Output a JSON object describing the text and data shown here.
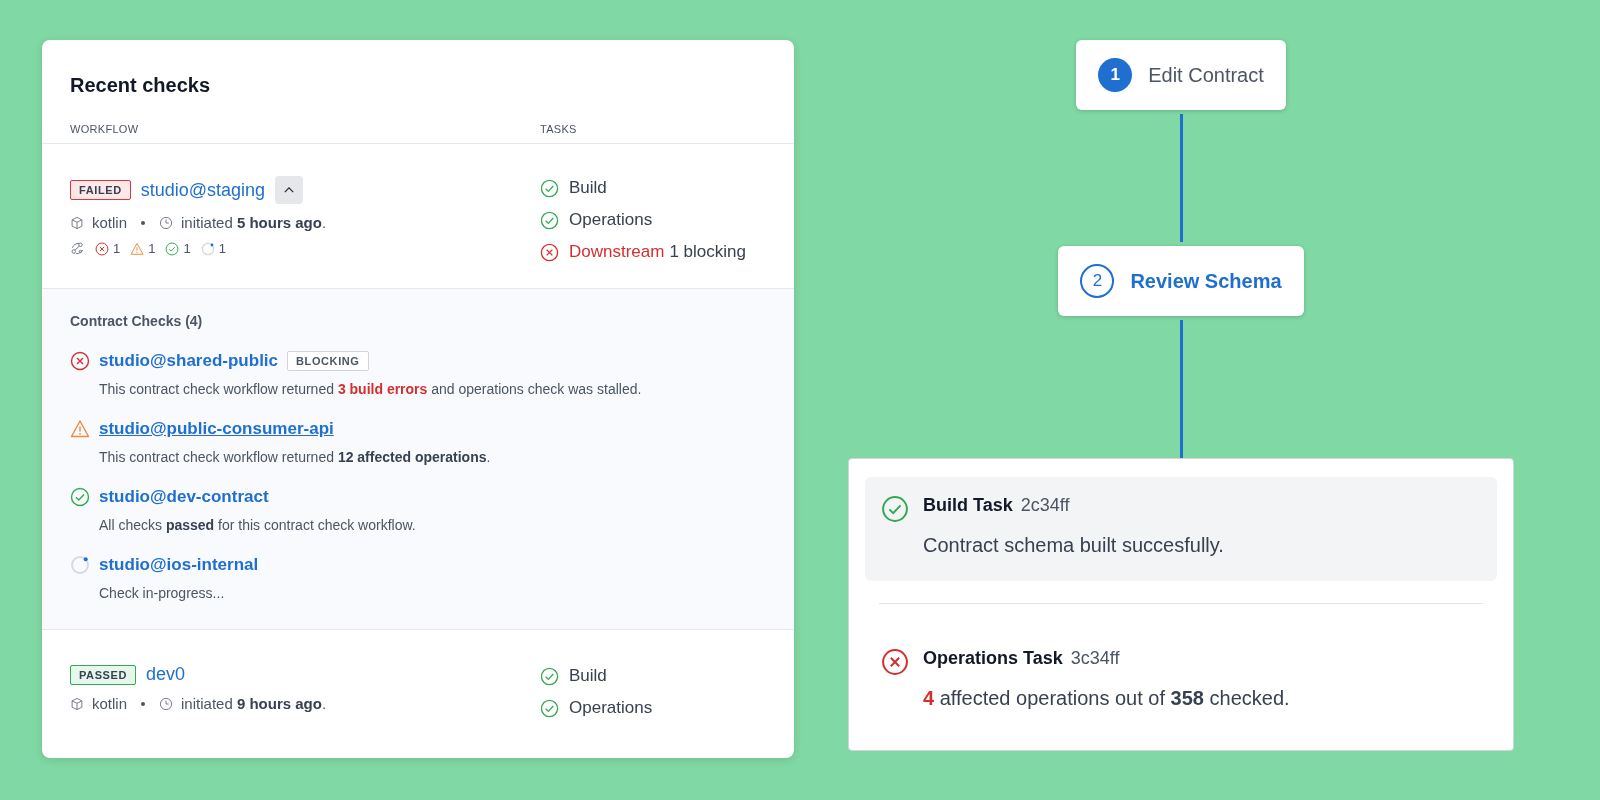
{
  "panel": {
    "title": "Recent checks",
    "columns": [
      "WORKFLOW",
      "TASKS"
    ],
    "rows": [
      {
        "tag": {
          "kind": "failed",
          "label": "FAILED"
        },
        "name": "studio@staging",
        "expanded": true,
        "language": "kotlin",
        "initiated": "initiated",
        "time": "5 hours ago",
        "period": ".",
        "stats": [
          {
            "kind": "error",
            "count": "1"
          },
          {
            "kind": "warning",
            "count": "1"
          },
          {
            "kind": "success",
            "count": "1"
          },
          {
            "kind": "pending",
            "count": "1"
          }
        ],
        "tasks": [
          {
            "kind": "success",
            "label": "Build"
          },
          {
            "kind": "success",
            "label": "Operations"
          },
          {
            "kind": "error",
            "label": "Downstream",
            "note": "1 blocking"
          }
        ],
        "details": {
          "heading": "Contract Checks (4)",
          "checks": [
            {
              "kind": "error",
              "name": "studio@shared-public",
              "hovered": false,
              "badge": "BLOCKING",
              "description": [
                {
                  "kind": "plain",
                  "text": "This contract check workflow returned "
                },
                {
                  "kind": "error",
                  "text": "3 build errors"
                },
                {
                  "kind": "plain",
                  "text": " and operations check was stalled."
                }
              ]
            },
            {
              "kind": "warning",
              "name": "studio@public-consumer-api",
              "hovered": true,
              "description": [
                {
                  "kind": "plain",
                  "text": "This contract check workflow returned "
                },
                {
                  "kind": "bold",
                  "text": "12 affected operations"
                },
                {
                  "kind": "plain",
                  "text": "."
                }
              ]
            },
            {
              "kind": "success",
              "name": "studio@dev-contract",
              "hovered": false,
              "description": [
                {
                  "kind": "plain",
                  "text": "All checks "
                },
                {
                  "kind": "bold",
                  "text": "passed"
                },
                {
                  "kind": "plain",
                  "text": " for this contract check workflow."
                }
              ]
            },
            {
              "kind": "pending",
              "name": "studio@ios-internal",
              "hovered": false,
              "description": [
                {
                  "kind": "plain",
                  "text": "Check in-progress..."
                }
              ]
            }
          ]
        }
      },
      {
        "tag": {
          "kind": "passed",
          "label": "PASSED"
        },
        "name": "dev0",
        "language": "kotlin",
        "initiated": "initiated",
        "time": "9 hours ago",
        "period": ".",
        "tasks": [
          {
            "kind": "success",
            "label": "Build"
          },
          {
            "kind": "success",
            "label": "Operations"
          }
        ]
      }
    ]
  },
  "steps": [
    {
      "number": "1",
      "label": "Edit Contract",
      "completed": true,
      "selected": false
    },
    {
      "number": "2",
      "label": "Review Schema",
      "completed": false,
      "selected": true
    }
  ],
  "task_card": {
    "items": [
      {
        "kind": "success",
        "selected": true,
        "title": "Build Task",
        "hash": "2c34ff",
        "description": [
          {
            "kind": "plain",
            "text": "Contract schema built succesfully."
          }
        ]
      },
      {
        "kind": "error",
        "selected": false,
        "title": "Operations Task",
        "hash": "3c34ff",
        "description": [
          {
            "kind": "error",
            "text": "4"
          },
          {
            "kind": "plain",
            "text": " affected operations out of "
          },
          {
            "kind": "bold",
            "text": "358"
          },
          {
            "kind": "plain",
            "text": " checked."
          }
        ]
      }
    ]
  }
}
